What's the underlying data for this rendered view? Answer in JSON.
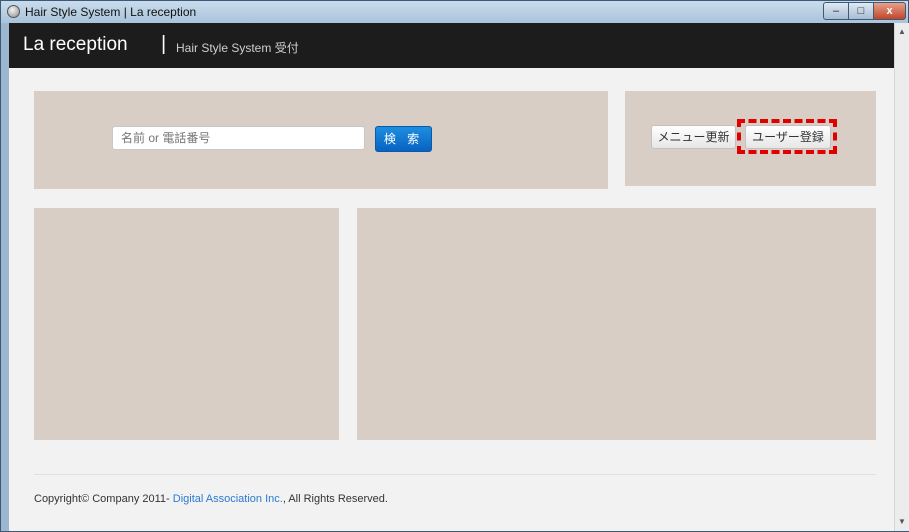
{
  "window": {
    "title": "Hair Style System | La reception",
    "controls": {
      "minimize": "–",
      "maximize": "□",
      "close": "x"
    }
  },
  "navbar": {
    "brand": "La reception",
    "separator": "|",
    "subtitle": "Hair Style System 受付"
  },
  "search": {
    "placeholder": "名前 or 電話番号",
    "button_label": "検 索"
  },
  "actions": {
    "menu_update_label": "メニュー更新",
    "user_register_label": "ユーザー登録"
  },
  "footer": {
    "prefix": "Copyright© Company 2011- ",
    "link_text": "Digital Association Inc.",
    "suffix": ", All Rights Reserved."
  },
  "colors": {
    "navbar": "#1c1c1c",
    "panel": "#d9cec5",
    "primary_button": "#1479d4",
    "highlight": "#e00000",
    "link": "#2a7ad2"
  }
}
